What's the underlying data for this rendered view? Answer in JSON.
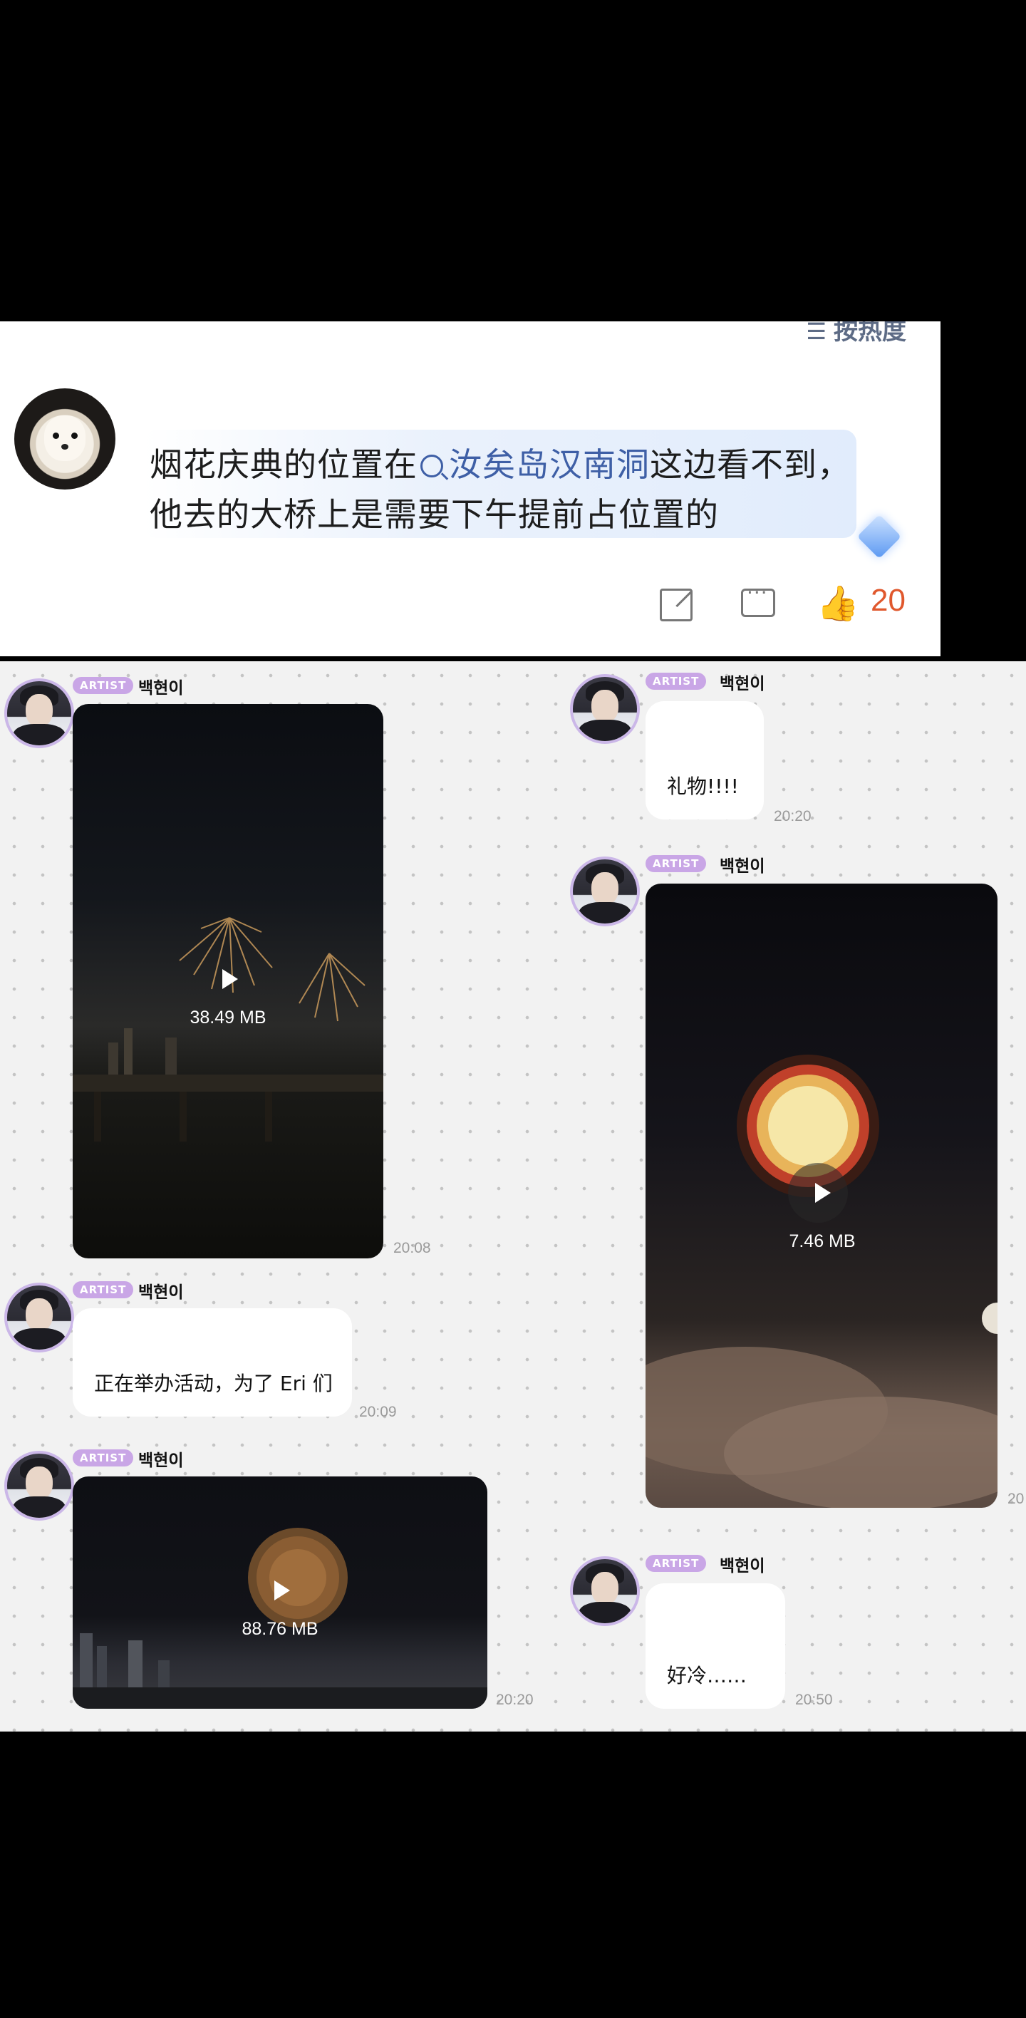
{
  "comment": {
    "sort_label": "按热度",
    "text_before": "烟花庆典的位置在",
    "topic": "汝矣岛汉南洞",
    "text_after": "这边看不到，他去的大桥上是需要下午提前占位置的",
    "like_count": "20",
    "colors": {
      "topic": "#3e5fa6",
      "like": "#e0582d"
    }
  },
  "chat": {
    "artist_tag": "ARTIST",
    "sender": "백현이",
    "messages": [
      {
        "type": "video",
        "size": "38.49 MB",
        "time": "20:08"
      },
      {
        "type": "text",
        "text": "正在举办活动，为了 Eri 们",
        "time": "20:09"
      },
      {
        "type": "video",
        "size": "88.76 MB",
        "time": "20:20"
      },
      {
        "type": "text",
        "text": "礼物!!!!",
        "time": "20:20"
      },
      {
        "type": "video",
        "size": "7.46 MB",
        "time": "20"
      },
      {
        "type": "text",
        "text": "好冷……",
        "time": "20:50"
      }
    ],
    "colors": {
      "artist_tag": "#c9a6e6",
      "avatar_ring": "#cbb7e8"
    }
  }
}
